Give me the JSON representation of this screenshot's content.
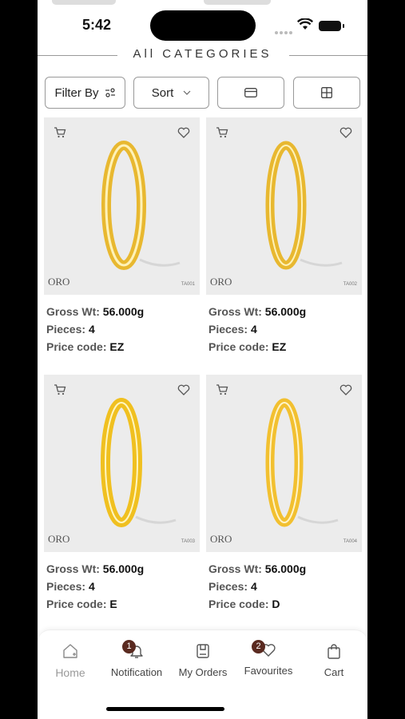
{
  "status_bar": {
    "time": "5:42"
  },
  "header": {
    "title": "All CATEGORIES"
  },
  "toolbar": {
    "filter_label": "Filter By",
    "sort_label": "Sort"
  },
  "products": [
    {
      "gross_label": "Gross Wt:",
      "gross": "56.000g",
      "pieces_label": "Pieces:",
      "pieces": "4",
      "price_label": "Price code:",
      "price": "EZ",
      "brand": "ORO",
      "code": "TA001"
    },
    {
      "gross_label": "Gross Wt:",
      "gross": "56.000g",
      "pieces_label": "Pieces:",
      "pieces": "4",
      "price_label": "Price code:",
      "price": "EZ",
      "brand": "ORO",
      "code": "TA002"
    },
    {
      "gross_label": "Gross Wt:",
      "gross": "56.000g",
      "pieces_label": "Pieces:",
      "pieces": "4",
      "price_label": "Price code:",
      "price": "E",
      "brand": "ORO",
      "code": "TA003"
    },
    {
      "gross_label": "Gross Wt:",
      "gross": "56.000g",
      "pieces_label": "Pieces:",
      "pieces": "4",
      "price_label": "Price code:",
      "price": "D",
      "brand": "ORO",
      "code": "TA004"
    }
  ],
  "nav": {
    "home": "Home",
    "notification": "Notification",
    "notification_badge": "1",
    "orders": "My Orders",
    "favourites": "Favourites",
    "favourites_badge": "2",
    "cart": "Cart"
  },
  "icons": {
    "cart": "cart-icon",
    "heart": "heart-icon",
    "filter": "filter-sliders-icon",
    "chevron": "chevron-down-icon",
    "list_view": "list-view-icon",
    "grid_view": "grid-view-icon",
    "home": "home-icon",
    "bell": "bell-icon",
    "orders": "orders-icon",
    "bag": "shopping-bag-icon"
  },
  "colors": {
    "accent": "#5a2a20",
    "card_bg": "#ececec",
    "gold": "#e8b830"
  }
}
